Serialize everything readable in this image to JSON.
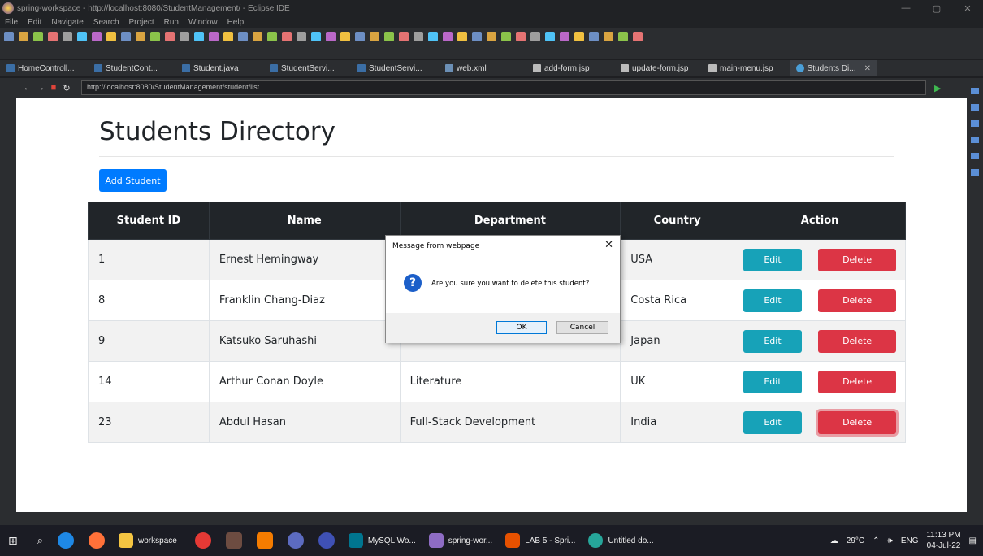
{
  "window": {
    "title": "spring-workspace - http://localhost:8080/StudentManagement/ - Eclipse IDE"
  },
  "menu": [
    "File",
    "Edit",
    "Navigate",
    "Search",
    "Project",
    "Run",
    "Window",
    "Help"
  ],
  "editor_tabs": [
    {
      "label": "HomeControll...",
      "kind": "java"
    },
    {
      "label": "StudentCont...",
      "kind": "java"
    },
    {
      "label": "Student.java",
      "kind": "java"
    },
    {
      "label": "StudentServi...",
      "kind": "java"
    },
    {
      "label": "StudentServi...",
      "kind": "java"
    },
    {
      "label": "web.xml",
      "kind": "xml"
    },
    {
      "label": "add-form.jsp",
      "kind": "jsp"
    },
    {
      "label": "update-form.jsp",
      "kind": "jsp"
    },
    {
      "label": "main-menu.jsp",
      "kind": "jsp"
    },
    {
      "label": "Students Di...",
      "kind": "browser",
      "active": true
    }
  ],
  "browser": {
    "url": "http://localhost:8080/StudentManagement/student/list"
  },
  "page": {
    "heading": "Students Directory",
    "add_button": "Add Student",
    "table": {
      "headers": [
        "Student ID",
        "Name",
        "Department",
        "Country",
        "Action"
      ],
      "rows": [
        {
          "id": "1",
          "name": "Ernest Hemingway",
          "department": "",
          "country": "USA"
        },
        {
          "id": "8",
          "name": "Franklin Chang-Diaz",
          "department": "",
          "country": "Costa Rica"
        },
        {
          "id": "9",
          "name": "Katsuko Saruhashi",
          "department": "",
          "country": "Japan"
        },
        {
          "id": "14",
          "name": "Arthur Conan Doyle",
          "department": "Literature",
          "country": "UK"
        },
        {
          "id": "23",
          "name": "Abdul Hasan",
          "department": "Full-Stack Development",
          "country": "India"
        }
      ],
      "edit_label": "Edit",
      "delete_label": "Delete"
    }
  },
  "dialog": {
    "title": "Message from webpage",
    "message": "Are you sure you want to delete this student?",
    "ok": "OK",
    "cancel": "Cancel",
    "icon": "question-icon"
  },
  "taskbar": {
    "apps": [
      "workspace",
      "MySQL Wo...",
      "spring-wor...",
      "LAB 5 - Spri...",
      "Untitled do..."
    ],
    "weather": "29°C",
    "lang": "ENG",
    "time": "11:13 PM",
    "date": "04-Jul-22"
  },
  "colors": {
    "primary": "#007bff",
    "info": "#17a2b8",
    "danger": "#dc3545",
    "table_header": "#212529"
  }
}
